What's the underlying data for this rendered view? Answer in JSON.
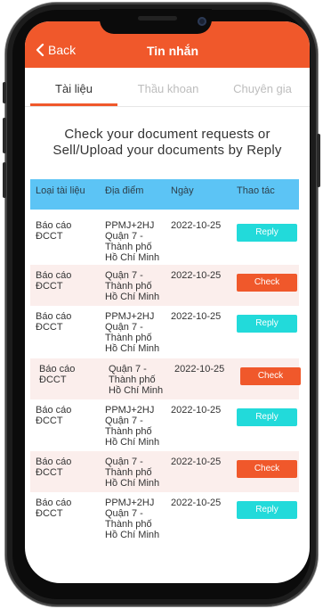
{
  "header": {
    "back_label": "Back",
    "title": "Tin nhắn"
  },
  "tabs": [
    {
      "label": "Tài liệu",
      "active": true
    },
    {
      "label": "Thầu khoan",
      "active": false
    },
    {
      "label": "Chuyên gia",
      "active": false
    }
  ],
  "intro_text": "Check your document requests or Sell/Upload your documents by Reply",
  "table": {
    "columns": [
      "Loại tài liệu",
      "Địa điểm",
      "Ngày",
      "Thao tác"
    ],
    "rows": [
      {
        "type": "Báo cáo\nĐCCT",
        "location": "PPMJ+2HJ\nQuận 7 -\nThành phố\nHồ Chí Minh",
        "date": "2022-10-25",
        "action": "Reply"
      },
      {
        "type": "Báo cáo\nĐCCT",
        "location": "Quận 7 -\nThành phố\nHồ Chí Minh",
        "date": "2022-10-25",
        "action": "Check"
      },
      {
        "type": "Báo cáo\nĐCCT",
        "location": "PPMJ+2HJ\nQuận 7 -\nThành phố\nHồ Chí Minh",
        "date": "2022-10-25",
        "action": "Reply"
      },
      {
        "type": "Báo cáo\nĐCCT",
        "location": "Quận 7 -\nThành phố\nHồ Chí Minh",
        "date": "2022-10-25",
        "action": "Check"
      },
      {
        "type": "Báo cáo\nĐCCT",
        "location": "PPMJ+2HJ\nQuận 7 -\nThành phố\nHồ Chí Minh",
        "date": "2022-10-25",
        "action": "Reply"
      },
      {
        "type": "Báo cáo\nĐCCT",
        "location": "Quận 7 -\nThành phố\nHồ Chí Minh",
        "date": "2022-10-25",
        "action": "Check"
      },
      {
        "type": "Báo cáo\nĐCCT",
        "location": "PPMJ+2HJ\nQuận 7 -\nThành phố\nHồ Chí Minh",
        "date": "2022-10-25",
        "action": "Reply"
      }
    ]
  },
  "colors": {
    "accent": "#f0582b",
    "table_header": "#5cc4f5",
    "reply_button": "#22dada",
    "check_button": "#f0582b",
    "alt_row": "#fbeeec"
  }
}
